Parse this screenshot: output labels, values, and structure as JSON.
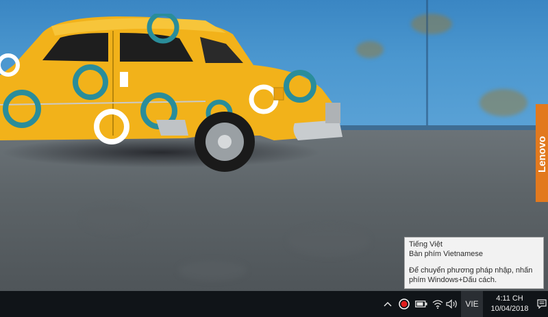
{
  "desktop": {
    "brand_tab": "Lenovo"
  },
  "tooltip": {
    "language": "Tiếng Việt",
    "keyboard": "Bàn phím Vietnamese",
    "hint_line1": "Để chuyển phương pháp nhập, nhấn",
    "hint_line2": "phím Windows+Dấu cách."
  },
  "taskbar": {
    "tray_icons": [
      "chevron-up-icon",
      "record-icon",
      "battery-icon",
      "wifi-icon",
      "volume-icon",
      "notification-icon"
    ],
    "language_indicator": "VIE",
    "time": "4:11 CH",
    "date": "10/04/2018"
  },
  "colors": {
    "taskbar": "#101418",
    "car_body": "#f2b21a",
    "car_rings": "#2a8d9a",
    "lenovo": "#e2791e",
    "wall": "#4b97cf"
  }
}
